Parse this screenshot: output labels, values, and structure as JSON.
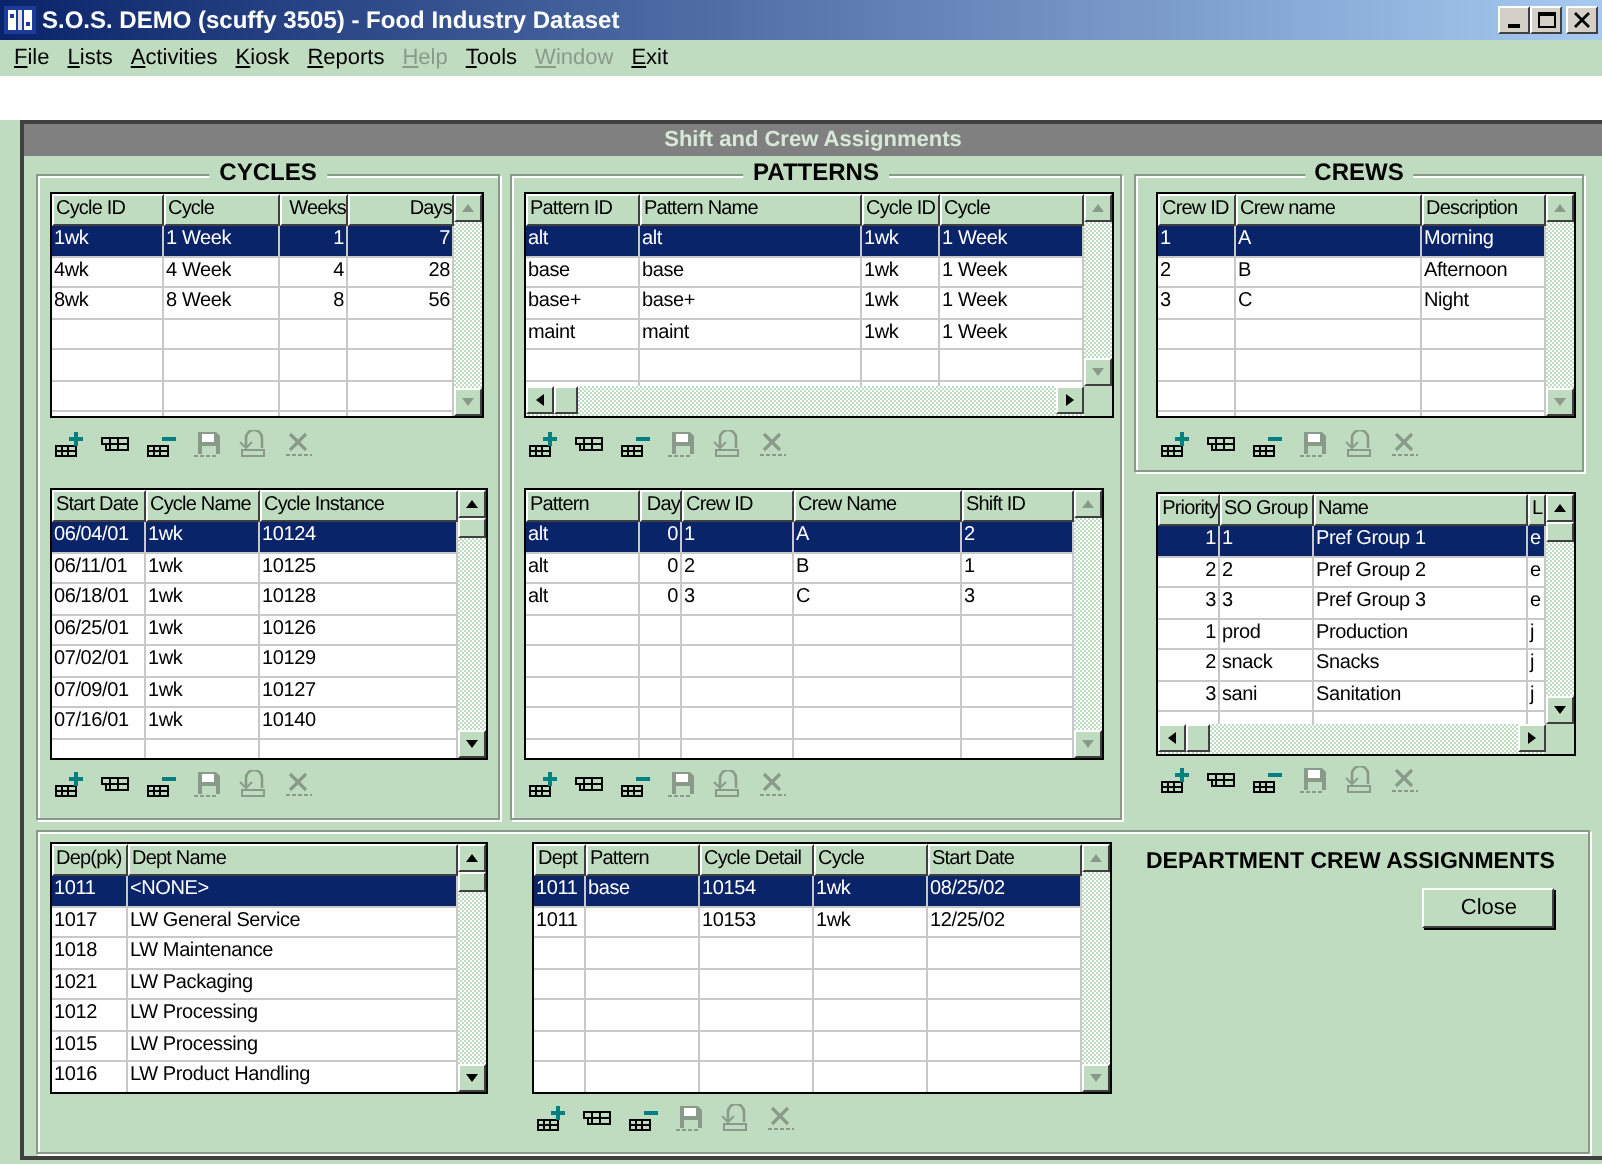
{
  "window": {
    "title": "S.O.S. DEMO (scuffy 3505) - Food Industry Dataset"
  },
  "menu": [
    {
      "label": "File",
      "disabled": false
    },
    {
      "label": "Lists",
      "disabled": false
    },
    {
      "label": "Activities",
      "disabled": false
    },
    {
      "label": "Kiosk",
      "disabled": false
    },
    {
      "label": "Reports",
      "disabled": false
    },
    {
      "label": "Help",
      "disabled": true
    },
    {
      "label": "Tools",
      "disabled": false
    },
    {
      "label": "Window",
      "disabled": true
    },
    {
      "label": "Exit",
      "disabled": false
    }
  ],
  "form": {
    "title": "Shift and Crew Assignments"
  },
  "cycles": {
    "title": "CYCLES",
    "grid": {
      "columns": [
        {
          "label": "Cycle ID"
        },
        {
          "label": "Cycle"
        },
        {
          "label": "Weeks",
          "numeric": true
        },
        {
          "label": "Days",
          "numeric": true
        }
      ],
      "rows": [
        {
          "cells": [
            "1wk",
            "1 Week",
            "1",
            "7"
          ],
          "selected": true
        },
        {
          "cells": [
            "4wk",
            "4 Week",
            "4",
            "28"
          ],
          "selected": false
        },
        {
          "cells": [
            "8wk",
            "8 Week",
            "8",
            "56"
          ],
          "selected": false
        }
      ]
    },
    "toolbar": [
      {
        "kind": "add",
        "disabled": false
      },
      {
        "kind": "insert",
        "disabled": false
      },
      {
        "kind": "delete",
        "disabled": false
      },
      {
        "kind": "save",
        "disabled": true
      },
      {
        "kind": "undo",
        "disabled": true
      },
      {
        "kind": "cancel",
        "disabled": true
      }
    ],
    "instances": {
      "columns": [
        {
          "label": "Start Date"
        },
        {
          "label": "Cycle Name"
        },
        {
          "label": "Cycle Instance"
        }
      ],
      "rows": [
        {
          "cells": [
            "06/04/01",
            "1wk",
            "10124"
          ],
          "selected": true
        },
        {
          "cells": [
            "06/11/01",
            "1wk",
            "10125"
          ],
          "selected": false
        },
        {
          "cells": [
            "06/18/01",
            "1wk",
            "10128"
          ],
          "selected": false
        },
        {
          "cells": [
            "06/25/01",
            "1wk",
            "10126"
          ],
          "selected": false
        },
        {
          "cells": [
            "07/02/01",
            "1wk",
            "10129"
          ],
          "selected": false
        },
        {
          "cells": [
            "07/09/01",
            "1wk",
            "10127"
          ],
          "selected": false
        },
        {
          "cells": [
            "07/16/01",
            "1wk",
            "10140"
          ],
          "selected": false
        }
      ]
    },
    "instances_toolbar": [
      {
        "kind": "add",
        "disabled": false
      },
      {
        "kind": "insert",
        "disabled": false
      },
      {
        "kind": "delete",
        "disabled": false
      },
      {
        "kind": "save",
        "disabled": true
      },
      {
        "kind": "undo",
        "disabled": true
      },
      {
        "kind": "cancel",
        "disabled": true
      }
    ]
  },
  "patterns": {
    "title": "PATTERNS",
    "grid": {
      "columns": [
        {
          "label": "Pattern ID"
        },
        {
          "label": "Pattern Name"
        },
        {
          "label": "Cycle ID"
        },
        {
          "label": "Cycle"
        }
      ],
      "rows": [
        {
          "cells": [
            "alt",
            "alt",
            "1wk",
            "1 Week"
          ],
          "selected": true
        },
        {
          "cells": [
            "base",
            "base",
            "1wk",
            "1 Week"
          ],
          "selected": false
        },
        {
          "cells": [
            "base+",
            "base+",
            "1wk",
            "1 Week"
          ],
          "selected": false
        },
        {
          "cells": [
            "maint",
            "maint",
            "1wk",
            "1 Week"
          ],
          "selected": false
        }
      ]
    },
    "toolbar": [
      {
        "kind": "add",
        "disabled": false
      },
      {
        "kind": "insert",
        "disabled": false
      },
      {
        "kind": "delete",
        "disabled": false
      },
      {
        "kind": "save",
        "disabled": true
      },
      {
        "kind": "undo",
        "disabled": true
      },
      {
        "kind": "cancel",
        "disabled": true
      }
    ],
    "details": {
      "columns": [
        {
          "label": "Pattern"
        },
        {
          "label": "Day",
          "numeric": true
        },
        {
          "label": "Crew ID"
        },
        {
          "label": "Crew Name"
        },
        {
          "label": "Shift ID"
        }
      ],
      "rows": [
        {
          "cells": [
            "alt",
            "0",
            "1",
            "A",
            "2"
          ],
          "selected": true
        },
        {
          "cells": [
            "alt",
            "0",
            "2",
            "B",
            "1"
          ],
          "selected": false
        },
        {
          "cells": [
            "alt",
            "0",
            "3",
            "C",
            "3"
          ],
          "selected": false
        }
      ]
    },
    "details_toolbar": [
      {
        "kind": "add",
        "disabled": false
      },
      {
        "kind": "insert",
        "disabled": false
      },
      {
        "kind": "delete",
        "disabled": false
      },
      {
        "kind": "save",
        "disabled": true
      },
      {
        "kind": "undo",
        "disabled": true
      },
      {
        "kind": "cancel",
        "disabled": true
      }
    ]
  },
  "crews": {
    "title": "CREWS",
    "grid": {
      "columns": [
        {
          "label": "Crew ID"
        },
        {
          "label": "Crew name"
        },
        {
          "label": "Description"
        }
      ],
      "rows": [
        {
          "cells": [
            "1",
            "A",
            "Morning"
          ],
          "selected": true
        },
        {
          "cells": [
            "2",
            "B",
            "Afternoon"
          ],
          "selected": false
        },
        {
          "cells": [
            "3",
            "C",
            "Night"
          ],
          "selected": false
        }
      ]
    },
    "toolbar": [
      {
        "kind": "add",
        "disabled": false
      },
      {
        "kind": "insert",
        "disabled": false
      },
      {
        "kind": "delete",
        "disabled": false
      },
      {
        "kind": "save",
        "disabled": true
      },
      {
        "kind": "undo",
        "disabled": true
      },
      {
        "kind": "cancel",
        "disabled": true
      }
    ]
  },
  "so_groups": {
    "grid": {
      "columns": [
        {
          "label": "Priority",
          "numeric": true
        },
        {
          "label": "SO Group"
        },
        {
          "label": "Name"
        },
        {
          "label": "L"
        }
      ],
      "rows": [
        {
          "cells": [
            "1",
            "1",
            "Pref Group 1",
            "e"
          ],
          "selected": true
        },
        {
          "cells": [
            "2",
            "2",
            "Pref Group 2",
            "e"
          ],
          "selected": false
        },
        {
          "cells": [
            "3",
            "3",
            "Pref Group 3",
            "e"
          ],
          "selected": false
        },
        {
          "cells": [
            "1",
            "prod",
            "Production",
            "j"
          ],
          "selected": false
        },
        {
          "cells": [
            "2",
            "snack",
            "Snacks",
            "j"
          ],
          "selected": false
        },
        {
          "cells": [
            "3",
            "sani",
            "Sanitation",
            "j"
          ],
          "selected": false
        }
      ]
    },
    "toolbar": [
      {
        "kind": "add",
        "disabled": false
      },
      {
        "kind": "insert",
        "disabled": false
      },
      {
        "kind": "delete",
        "disabled": false
      },
      {
        "kind": "save",
        "disabled": true
      },
      {
        "kind": "undo",
        "disabled": true
      },
      {
        "kind": "cancel",
        "disabled": true
      }
    ]
  },
  "departments": {
    "grid": {
      "columns": [
        {
          "label": "Dep(pk)"
        },
        {
          "label": "Dept Name"
        }
      ],
      "rows": [
        {
          "cells": [
            "1011",
            "<NONE>"
          ],
          "selected": true
        },
        {
          "cells": [
            "1017",
            "LW General Service"
          ],
          "selected": false
        },
        {
          "cells": [
            "1018",
            "LW Maintenance"
          ],
          "selected": false
        },
        {
          "cells": [
            "1021",
            "LW Packaging"
          ],
          "selected": false
        },
        {
          "cells": [
            "1012",
            "LW Processing"
          ],
          "selected": false
        },
        {
          "cells": [
            "1015",
            "LW Processing"
          ],
          "selected": false
        },
        {
          "cells": [
            "1016",
            "LW Product Handling"
          ],
          "selected": false
        }
      ]
    }
  },
  "dept_crews": {
    "title": "DEPARTMENT CREW ASSIGNMENTS",
    "grid": {
      "columns": [
        {
          "label": "Dept"
        },
        {
          "label": "Pattern"
        },
        {
          "label": "Cycle Detail"
        },
        {
          "label": "Cycle"
        },
        {
          "label": "Start Date"
        }
      ],
      "rows": [
        {
          "cells": [
            "1011",
            "base",
            "10154",
            "1wk",
            "08/25/02"
          ],
          "selected": true
        },
        {
          "cells": [
            "1011",
            "",
            "10153",
            "1wk",
            "12/25/02"
          ],
          "selected": false
        }
      ]
    },
    "toolbar": [
      {
        "kind": "add",
        "disabled": false
      },
      {
        "kind": "insert",
        "disabled": false
      },
      {
        "kind": "delete",
        "disabled": false
      },
      {
        "kind": "save",
        "disabled": true
      },
      {
        "kind": "undo",
        "disabled": true
      },
      {
        "kind": "cancel",
        "disabled": true
      }
    ],
    "close_button": "Close"
  }
}
